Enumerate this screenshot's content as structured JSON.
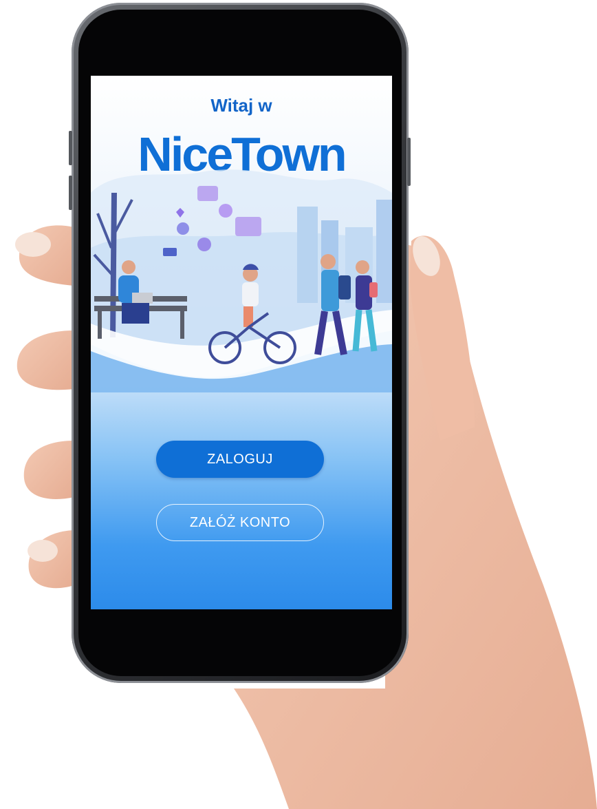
{
  "screen": {
    "welcome_text": "Witaj w",
    "logo_text": "NiceTown"
  },
  "buttons": {
    "login_label": "ZALOGUJ",
    "register_label": "ZAŁÓŻ KONTO"
  },
  "colors": {
    "brand_blue": "#0f6fd6",
    "background_top": "#ffffff",
    "background_bottom": "#2c8bea"
  },
  "icons": {
    "illustration": "city-park-people-illustration"
  }
}
